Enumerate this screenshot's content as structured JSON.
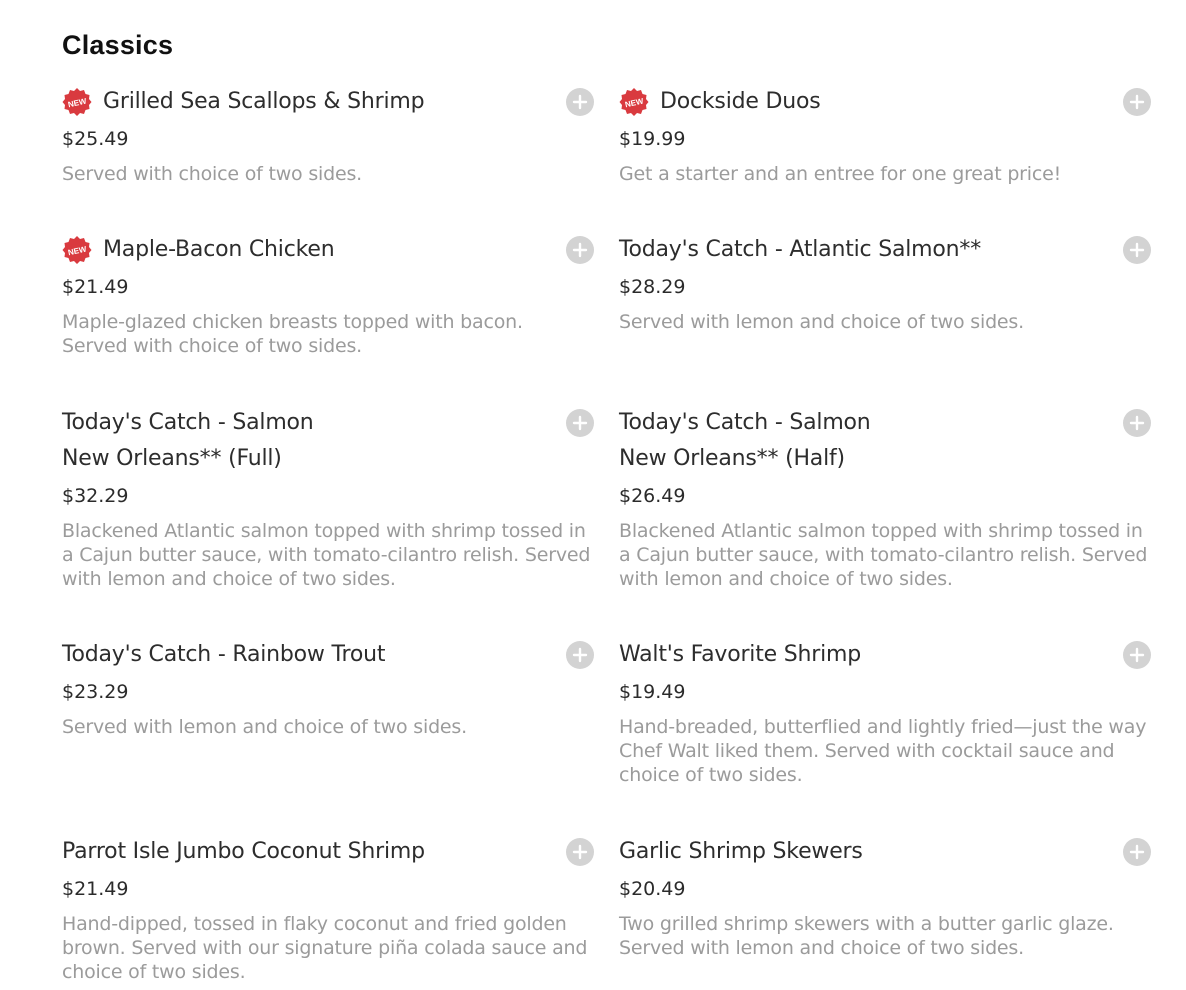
{
  "section": {
    "title": "Classics"
  },
  "badge": {
    "label": "NEW",
    "color": "#d93a3f"
  },
  "add_icon": "plus-circle-icon",
  "items": [
    {
      "name": "Grilled Sea Scallops & Shrimp",
      "price": "$25.49",
      "description": "Served with choice of two sides.",
      "is_new": true
    },
    {
      "name": "Dockside Duos",
      "price": "$19.99",
      "description": "Get a starter and an entree for one great price!",
      "is_new": true
    },
    {
      "name": "Maple-Bacon Chicken",
      "price": "$21.49",
      "description": "Maple-glazed chicken breasts topped with bacon. Served with choice of two sides.",
      "is_new": true
    },
    {
      "name": "Today's Catch - Atlantic Salmon**",
      "price": "$28.29",
      "description": "Served with lemon and choice of two sides.",
      "is_new": false
    },
    {
      "name": "Today's Catch - Salmon New Orleans** (Full)",
      "price": "$32.29",
      "description": "Blackened Atlantic salmon topped with shrimp tossed in a Cajun butter sauce, with tomato-cilantro relish. Served with lemon and choice of two sides.",
      "is_new": false
    },
    {
      "name": "Today's Catch - Salmon New Orleans** (Half)",
      "price": "$26.49",
      "description": "Blackened Atlantic salmon topped with shrimp tossed in a Cajun butter sauce, with tomato-cilantro relish. Served with lemon and choice of two sides.",
      "is_new": false
    },
    {
      "name": "Today's Catch - Rainbow Trout",
      "price": "$23.29",
      "description": "Served with lemon and choice of two sides.",
      "is_new": false
    },
    {
      "name": "Walt's Favorite Shrimp",
      "price": "$19.49",
      "description": "Hand-breaded, butterflied and lightly fried—just the way Chef Walt liked them. Served with cocktail sauce and choice of two sides.",
      "is_new": false
    },
    {
      "name": "Parrot Isle Jumbo Coconut Shrimp",
      "price": "$21.49",
      "description": "Hand-dipped, tossed in flaky coconut and fried golden brown. Served with our signature piña colada sauce and choice of two sides.",
      "is_new": false
    },
    {
      "name": "Garlic Shrimp Skewers",
      "price": "$20.49",
      "description": "Two grilled shrimp skewers with a butter garlic glaze. Served with lemon and choice of two sides.",
      "is_new": false
    }
  ]
}
